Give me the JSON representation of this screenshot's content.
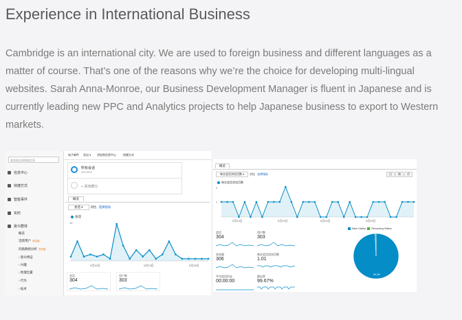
{
  "heading": "Experience in International Business",
  "paragraph": "Cambridge is an international city. We are used to foreign business and different languages as a matter of course. That’s one of the reasons why we’re the choice for developing multi-lingual websites. Sarah Anna-Monroe, our Business Development Manager is fluent in Japanese and is currently leading new PPC and Analytics projects to help Japanese business to export to Western markets.",
  "left_screenshot": {
    "search_placeholder": "查找报告和帮助信息",
    "nav": [
      "信息中心",
      "快捷方式",
      "智能事件",
      "实时",
      "受众群体"
    ],
    "sub_items": [
      {
        "label": "概览",
        "badge": ""
      },
      {
        "label": "活跃用户",
        "badge": "测试版"
      },
      {
        "label": "同类群组分析",
        "badge": "测试版"
      },
      {
        "label": "› 受众特征",
        "badge": ""
      },
      {
        "label": "› 兴趣",
        "badge": ""
      },
      {
        "label": "› 地理位置",
        "badge": ""
      },
      {
        "label": "› 行为",
        "badge": ""
      },
      {
        "label": "› 技术",
        "badge": ""
      }
    ],
    "topbar": [
      "电子邮件",
      "导出 ▾",
      "添加到信息中心",
      "快捷方式"
    ],
    "segment_all": "所有会话",
    "segment_pct": "100.00%",
    "segment_add": "+ 添加细分",
    "tab": "概览",
    "metric_dd": "会话 ▾",
    "vs": "对比",
    "select_metric": "选择指标",
    "interval": "时",
    "legend": "会话",
    "y_label": "10",
    "x_ticks": [
      "5月22日",
      "5月23日",
      "5月25日"
    ],
    "kpis": [
      {
        "label": "会话",
        "value": "304"
      },
      {
        "label": "用户数",
        "value": "303"
      }
    ]
  },
  "right_screenshot": {
    "tab": "概览",
    "dropdown": "每次会话浏览页数 ▾",
    "vs": "对比",
    "select_metric": "选择指标",
    "buttons": [
      "日",
      "周",
      "月"
    ],
    "legend": "每次会话浏览页数",
    "y_ticks": [
      "2",
      "1"
    ],
    "x_ticks": [
      "5月22日",
      "5月23日",
      "5月24日",
      "5月25日"
    ],
    "kpis": [
      {
        "label": "会话",
        "value": "304"
      },
      {
        "label": "用户数",
        "value": "303"
      },
      {
        "label": "浏览量",
        "value": "306"
      },
      {
        "label": "每次会话浏览页数",
        "value": "1.01"
      },
      {
        "label": "平均会话时长",
        "value": "00:00:00"
      },
      {
        "label": "跳出率",
        "value": "99.67%"
      }
    ],
    "pie_legend": [
      "New Visitor",
      "Returning Visitor"
    ],
    "pie_label": "99.3%"
  },
  "colors": {
    "accent": "#058dc7",
    "returning": "#50b432"
  },
  "chart_data": [
    {
      "type": "line",
      "series": [
        {
          "name": "会话",
          "values": [
            2,
            9,
            2,
            3,
            2,
            3,
            1,
            17,
            7,
            1,
            5,
            2,
            5,
            1,
            3,
            9,
            3,
            1,
            1,
            1,
            1,
            1
          ]
        }
      ]
    },
    {
      "type": "line",
      "series": [
        {
          "name": "每次会话浏览页数",
          "values": [
            1,
            1,
            1,
            0,
            1,
            0,
            1,
            0,
            1,
            1,
            1,
            2,
            1,
            0,
            1,
            1,
            1,
            0,
            0,
            1,
            1,
            0,
            1,
            0,
            0,
            0,
            1,
            1,
            1,
            0,
            0,
            1,
            1,
            1
          ]
        }
      ]
    },
    {
      "type": "pie",
      "categories": [
        "New Visitor",
        "Returning Visitor"
      ],
      "values": [
        99.3,
        0.7
      ]
    }
  ]
}
